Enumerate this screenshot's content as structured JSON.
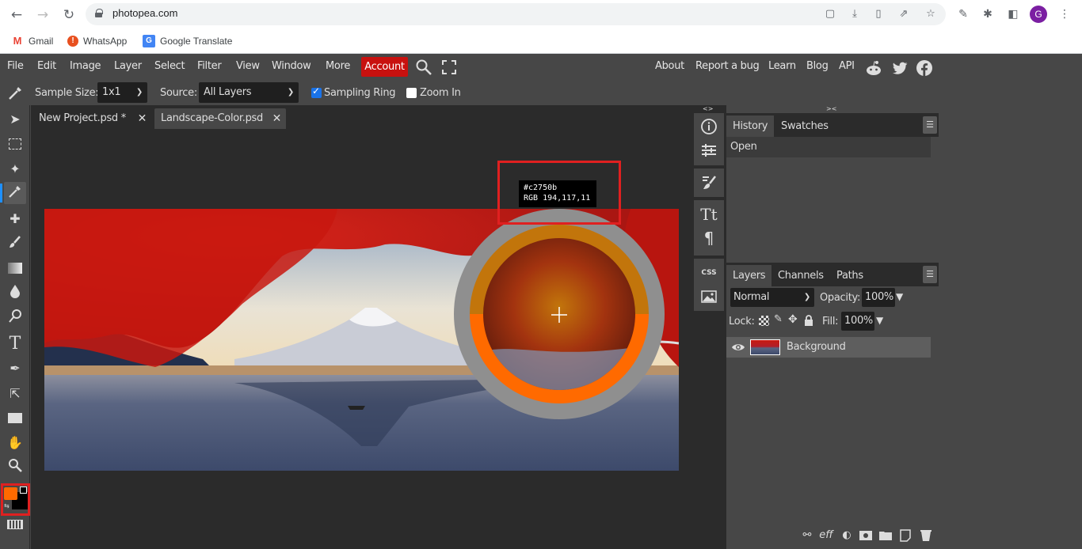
{
  "browser": {
    "url": "photopea.com",
    "nav": {
      "back": "←",
      "forward": "→",
      "reload": "↻"
    },
    "omnibox_icons": [
      "clipboard-icon",
      "install-icon",
      "page-icon",
      "share-icon",
      "star-icon"
    ],
    "extension_icons": [
      "eyedropper-extension-icon",
      "puzzle-extensions-icon",
      "side-panel-icon"
    ],
    "profile_initial": "G",
    "menu_icon": "⋮",
    "bookmarks": [
      {
        "label": "Gmail",
        "icon": "gmail-icon",
        "color": "#ea4335",
        "glyph": "M"
      },
      {
        "label": "WhatsApp",
        "icon": "whatsapp-icon",
        "color": "#e8501f",
        "glyph": "!"
      },
      {
        "label": "Google Translate",
        "icon": "google-translate-icon",
        "color": "#4285f4",
        "glyph": "G"
      }
    ]
  },
  "app": {
    "menu": [
      "File",
      "Edit",
      "Image",
      "Layer",
      "Select",
      "Filter",
      "View",
      "Window",
      "More"
    ],
    "account_label": "Account",
    "account_color": "#c8110f",
    "right_links": [
      "About",
      "Report a bug",
      "Learn",
      "Blog",
      "API"
    ],
    "social": [
      "reddit-icon",
      "twitter-icon",
      "facebook-icon"
    ]
  },
  "options": {
    "sample_size_label": "Sample Size:",
    "sample_size_value": "1x1",
    "source_label": "Source:",
    "source_value": "All Layers",
    "sampling_ring_label": "Sampling Ring",
    "sampling_ring_checked": true,
    "zoom_in_label": "Zoom In",
    "zoom_in_checked": false
  },
  "tools": [
    {
      "name": "move-tool",
      "glyph": "➤"
    },
    {
      "name": "rectangle-select-tool",
      "glyph": "⬚"
    },
    {
      "name": "magic-wand-tool",
      "glyph": "✦"
    },
    {
      "name": "eyedropper-tool",
      "glyph": "✎",
      "active": true
    },
    {
      "name": "healing-brush-tool",
      "glyph": "✚"
    },
    {
      "name": "brush-tool",
      "glyph": "🖌"
    },
    {
      "name": "gradient-tool",
      "glyph": "▬"
    },
    {
      "name": "blur-tool",
      "glyph": "💧"
    },
    {
      "name": "dodge-tool",
      "glyph": "⚲"
    },
    {
      "name": "type-tool",
      "glyph": "T"
    },
    {
      "name": "pen-tool",
      "glyph": "✒"
    },
    {
      "name": "path-select-tool",
      "glyph": "⇱"
    },
    {
      "name": "shape-tool",
      "glyph": "▭"
    },
    {
      "name": "hand-tool",
      "glyph": "✋"
    },
    {
      "name": "zoom-tool",
      "glyph": "🔍"
    }
  ],
  "colors": {
    "foreground": "#ff6a00",
    "background": "#000000"
  },
  "documents": {
    "tabs": [
      {
        "label": "New Project.psd *",
        "active": true
      },
      {
        "label": "Landscape-Color.psd",
        "active": false
      }
    ],
    "close_glyph": "✕"
  },
  "sampler": {
    "hex": "#c2750b",
    "rgb": "RGB 194,117,11",
    "current_color": "#c2750b",
    "new_color": "#ff6a00"
  },
  "side_icons": [
    "info-icon",
    "adjustments-icon",
    "brush-presets-icon",
    "character-icon",
    "paragraph-icon",
    "css-icon",
    "image-icon"
  ],
  "history_panel": {
    "tabs": [
      "History",
      "Swatches"
    ],
    "items": [
      "Open"
    ]
  },
  "layers_panel": {
    "tabs": [
      "Layers",
      "Channels",
      "Paths"
    ],
    "blend_mode": "Normal",
    "opacity_label": "Opacity:",
    "opacity": "100%",
    "lock_label": "Lock:",
    "fill_label": "Fill:",
    "fill": "100%",
    "layers": [
      {
        "name": "Background",
        "visible": true
      }
    ],
    "footer_icons": [
      "link-icon",
      "effects-icon",
      "adjustment-layer-icon",
      "mask-icon",
      "folder-icon",
      "new-layer-icon",
      "trash-icon"
    ]
  }
}
